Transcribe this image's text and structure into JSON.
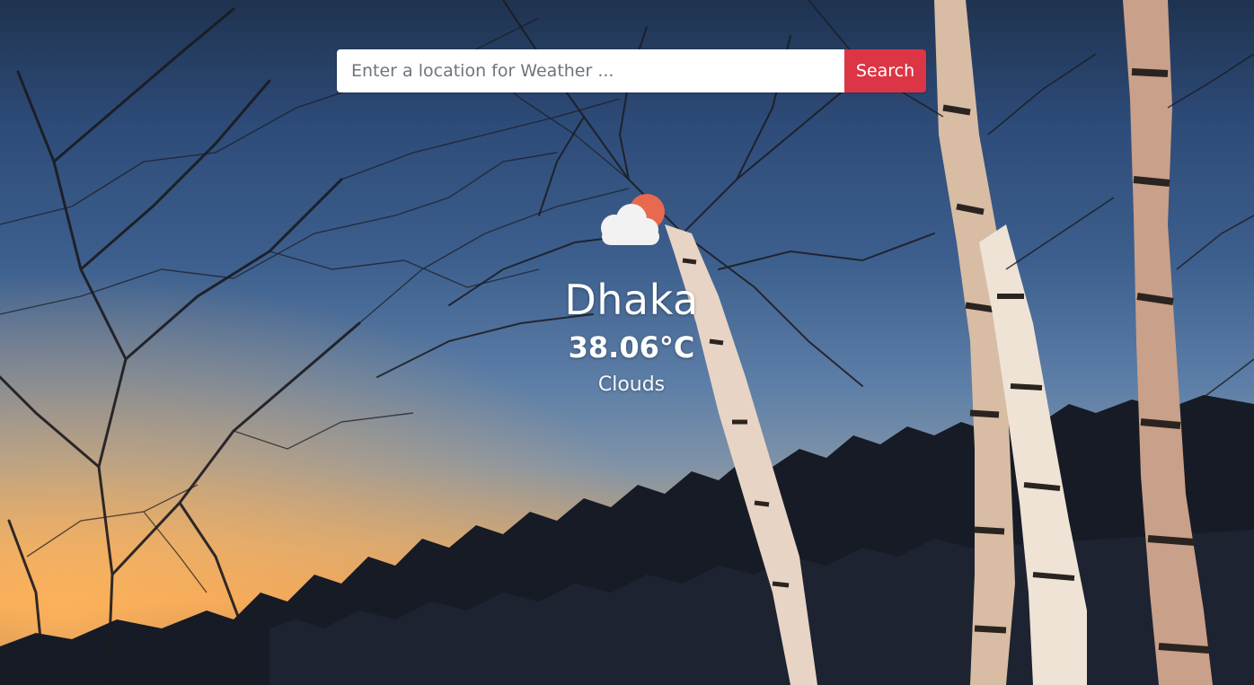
{
  "search": {
    "placeholder": "Enter a location for Weather ...",
    "value": "",
    "button_label": "Search"
  },
  "weather": {
    "icon": "clouds-with-sun-icon",
    "city": "Dhaka",
    "temperature": "38.06°C",
    "condition": "Clouds"
  },
  "colors": {
    "button": "#dc3545",
    "sun": "#e8694f",
    "cloud": "#f2f2f2"
  }
}
